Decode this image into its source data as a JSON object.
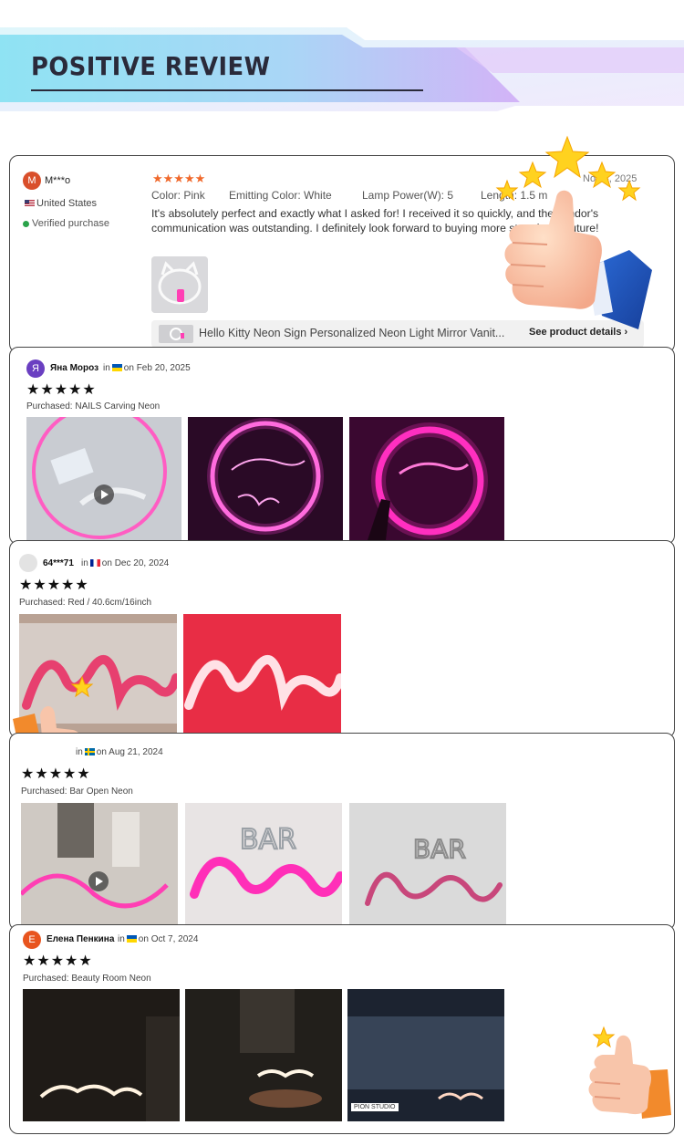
{
  "banner": {
    "title": "POSITIVE REVIEW"
  },
  "review1": {
    "avatar": "M",
    "name": "M***o",
    "country": "United States",
    "verified": "Verified purchase",
    "date": "Nov 3, 2025",
    "stars": "★★★★★",
    "color_label": "Color:",
    "color_value": "Pink",
    "emit_label": "Emitting Color:",
    "emit_value": "White",
    "lamp_label": "Lamp Power(W):",
    "lamp_value": "5",
    "length_label": "Length:",
    "length_value": "1.5 m",
    "text": "It's absolutely perfect and exactly what I asked for! I received it so quickly, and the vendor's communication was outstanding. I definitely look forward to buying more store in the future!",
    "product_name": "Hello Kitty Neon Sign Personalized Neon Light Mirror Vanit...",
    "product_link": "See product details",
    "product_link_icon": "chevron-right-icon"
  },
  "review2": {
    "avatar": "Я",
    "name": "Яна Мороз",
    "in": "in",
    "date": "on Feb 20, 2025",
    "stars": "★★★★★",
    "purchased": "Purchased: NAILS Carving Neon"
  },
  "review3": {
    "name": "64***71",
    "in": "in",
    "date": "on Dec 20, 2024",
    "stars": "★★★★★",
    "purchased": "Purchased: Red / 40.6cm/16inch"
  },
  "review4": {
    "in": "in",
    "date": "on Aug 21, 2024",
    "stars": "★★★★★",
    "purchased": "Purchased: Bar Open Neon"
  },
  "review5": {
    "avatar": "Е",
    "name": "Елена Пенкина",
    "in": "in",
    "date": "on Oct 7, 2024",
    "stars": "★★★★★",
    "purchased": "Purchased: Beauty Room Neon",
    "watermark": "PION STUDIO"
  },
  "colors": {
    "accent_star": "#f0682b",
    "banner_gradient": [
      "#8fe0f0",
      "#c9a8f5"
    ],
    "neon_pink": "#ff3fb4",
    "neon_red": "#ff2d4d"
  },
  "icons": [
    "thumbs-up-icon",
    "star-icon",
    "play-icon",
    "verified-icon",
    "chevron-right-icon"
  ]
}
